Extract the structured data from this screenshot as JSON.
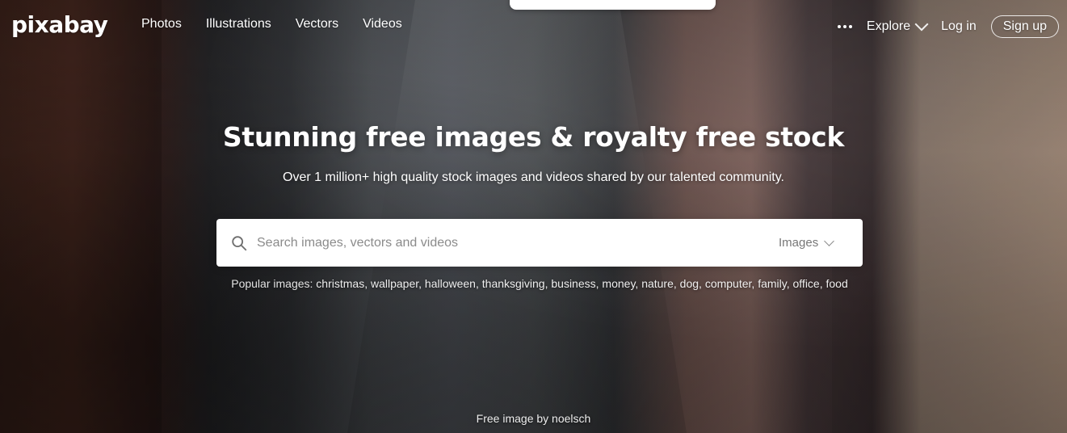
{
  "brand": {
    "logo_text": "pixabay"
  },
  "nav": {
    "links": [
      {
        "label": "Photos"
      },
      {
        "label": "Illustrations"
      },
      {
        "label": "Vectors"
      },
      {
        "label": "Videos"
      }
    ],
    "right": {
      "more_icon": "more-dots-icon",
      "explore_label": "Explore",
      "login_label": "Log in",
      "signup_label": "Sign up"
    }
  },
  "hero": {
    "headline": "Stunning free images & royalty free stock",
    "subheadline": "Over 1 million+ high quality stock images and videos shared by our talented community."
  },
  "search": {
    "icon": "search-icon",
    "placeholder": "Search images, vectors and videos",
    "type_selected": "Images"
  },
  "popular": {
    "label": "Popular images:",
    "tags": [
      "christmas",
      "wallpaper",
      "halloween",
      "thanksgiving",
      "business",
      "money",
      "nature",
      "dog",
      "computer",
      "family",
      "office",
      "food"
    ]
  },
  "credit": {
    "text": "Free image by noelsch"
  },
  "colors": {
    "text": "#ffffff",
    "search_bg": "#ffffff",
    "placeholder": "#8b8b8b"
  }
}
